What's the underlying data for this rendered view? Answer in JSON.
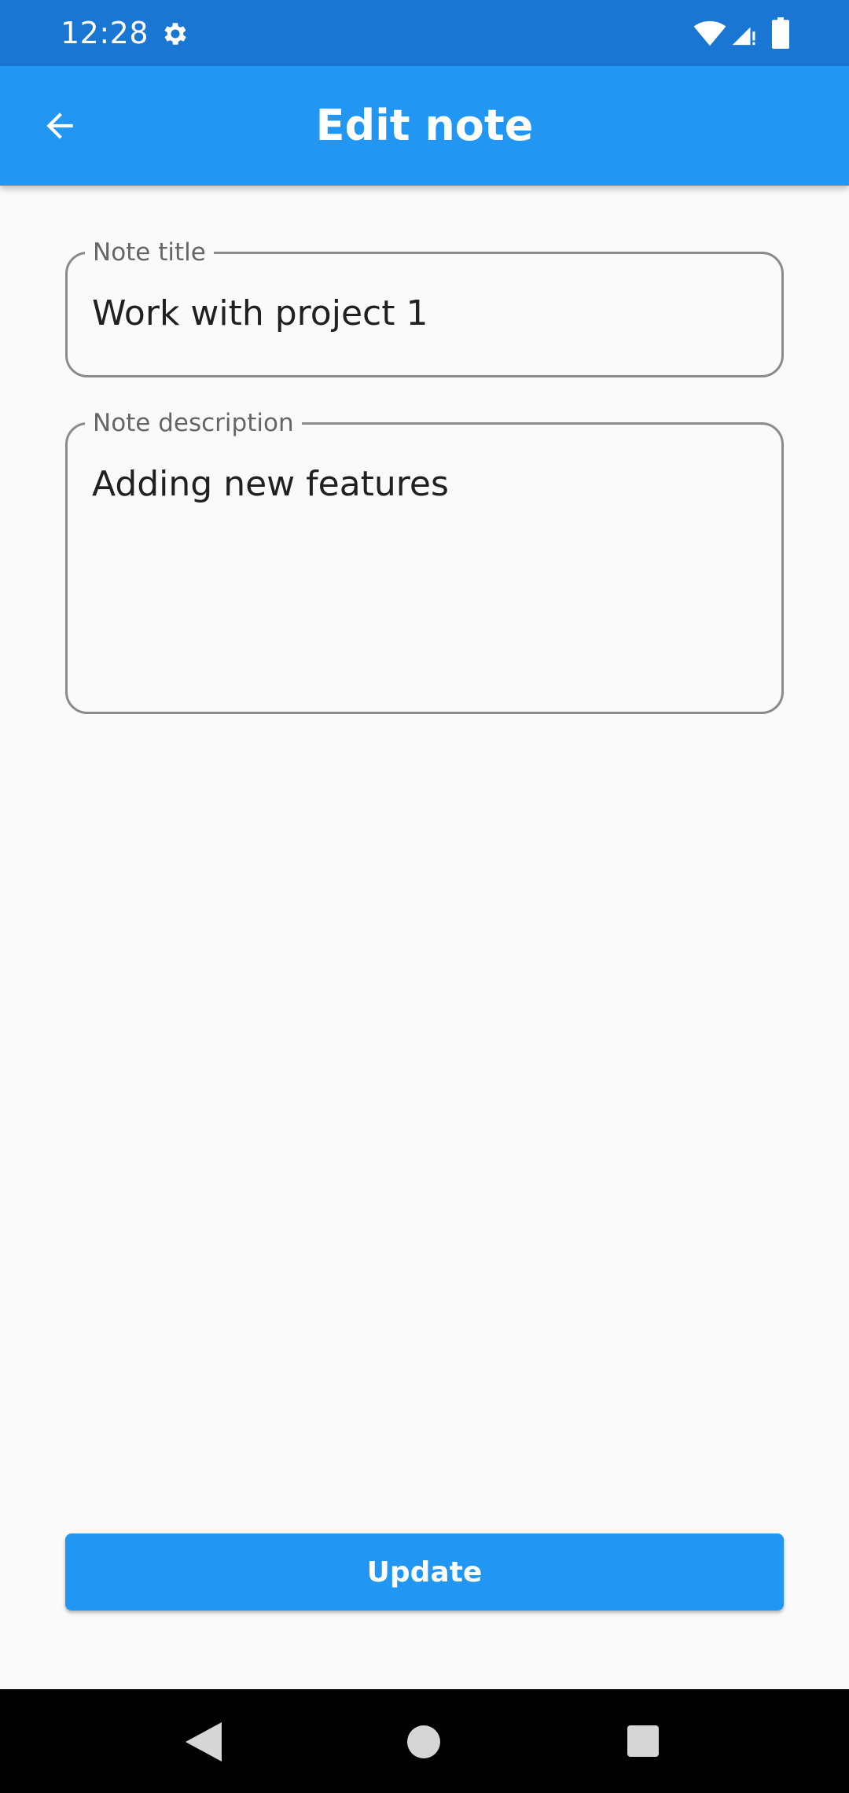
{
  "status_bar": {
    "time": "12:28",
    "icons": [
      "gear-icon",
      "wifi-icon",
      "signal-icon",
      "battery-icon"
    ]
  },
  "app_bar": {
    "title": "Edit note",
    "back_icon": "arrow-back-icon"
  },
  "form": {
    "title_field": {
      "label": "Note title",
      "value": "Work with project 1"
    },
    "description_field": {
      "label": "Note description",
      "value": "Adding new features"
    }
  },
  "actions": {
    "update_label": "Update"
  },
  "nav_bar": {
    "icons": [
      "nav-back-icon",
      "nav-home-icon",
      "nav-recents-icon"
    ]
  },
  "colors": {
    "primary": "#2196f3",
    "primary_dark": "#1976d2",
    "background": "#fafafa",
    "field_border": "#8a8a8a",
    "label_text": "#666666",
    "value_text": "#202020"
  }
}
